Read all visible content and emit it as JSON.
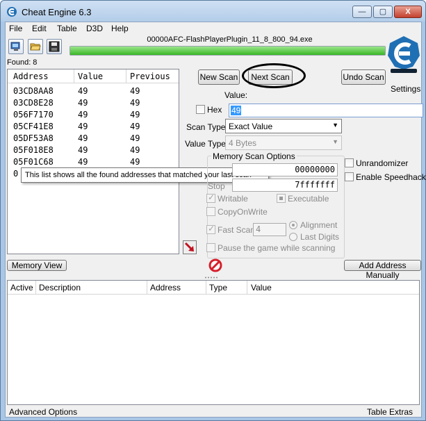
{
  "window": {
    "title": "Cheat Engine 6.3",
    "controls": {
      "minimize": "—",
      "maximize": "▢",
      "close": "X"
    }
  },
  "menu": [
    "File",
    "Edit",
    "Table",
    "D3D",
    "Help"
  ],
  "process": {
    "name": "00000AFC-FlashPlayerPlugin_11_8_800_94.exe",
    "progress_percent": 100
  },
  "toolbar": {
    "icons": [
      "open-process-icon",
      "open-file-icon",
      "save-icon"
    ]
  },
  "logo": {
    "settings_label": "Settings"
  },
  "found": "Found: 8",
  "results": {
    "headers": [
      "Address",
      "Value",
      "Previous"
    ],
    "rows": [
      [
        "03CD8AA8",
        "49",
        "49"
      ],
      [
        "03CD8E28",
        "49",
        "49"
      ],
      [
        "056F7170",
        "49",
        "49"
      ],
      [
        "05CF41E8",
        "49",
        "49"
      ],
      [
        "05DF53A8",
        "49",
        "49"
      ],
      [
        "05F018E8",
        "49",
        "49"
      ],
      [
        "05F01C68",
        "49",
        "49"
      ],
      [
        "0",
        "",
        ""
      ]
    ],
    "tooltip": "This list shows all the found addresses that matched your last scan"
  },
  "scan": {
    "new_scan": "New Scan",
    "next_scan": "Next Scan",
    "undo_scan": "Undo Scan",
    "value_label": "Value:",
    "hex_label": "Hex",
    "value": "49",
    "scan_type_label": "Scan Type",
    "scan_type": "Exact Value",
    "value_type_label": "Value Type",
    "value_type": "4 Bytes"
  },
  "memory_options": {
    "title": "Memory Scan Options",
    "start_value": "00000000",
    "stop_label": "Stop",
    "stop_value": "7fffffff",
    "writable": "Writable",
    "executable": "Executable",
    "copy_on_write": "CopyOnWrite",
    "fast_scan": "Fast Scan",
    "fast_scan_value": "4",
    "alignment": "Alignment",
    "last_digits": "Last Digits",
    "pause": "Pause the game while scanning"
  },
  "side_options": {
    "unrandomizer": "Unrandomizer",
    "speedhack": "Enable Speedhack"
  },
  "buttons": {
    "memory_view": "Memory View",
    "add_address": "Add Address Manually"
  },
  "address_list": {
    "headers": [
      "Active",
      "Description",
      "Address",
      "Type",
      "Value"
    ]
  },
  "status": {
    "advanced": "Advanced Options",
    "extras": "Table Extras"
  },
  "colors": {
    "title_bg": "#b3cde9",
    "selection": "#3399ff",
    "progress": "#39b726"
  }
}
